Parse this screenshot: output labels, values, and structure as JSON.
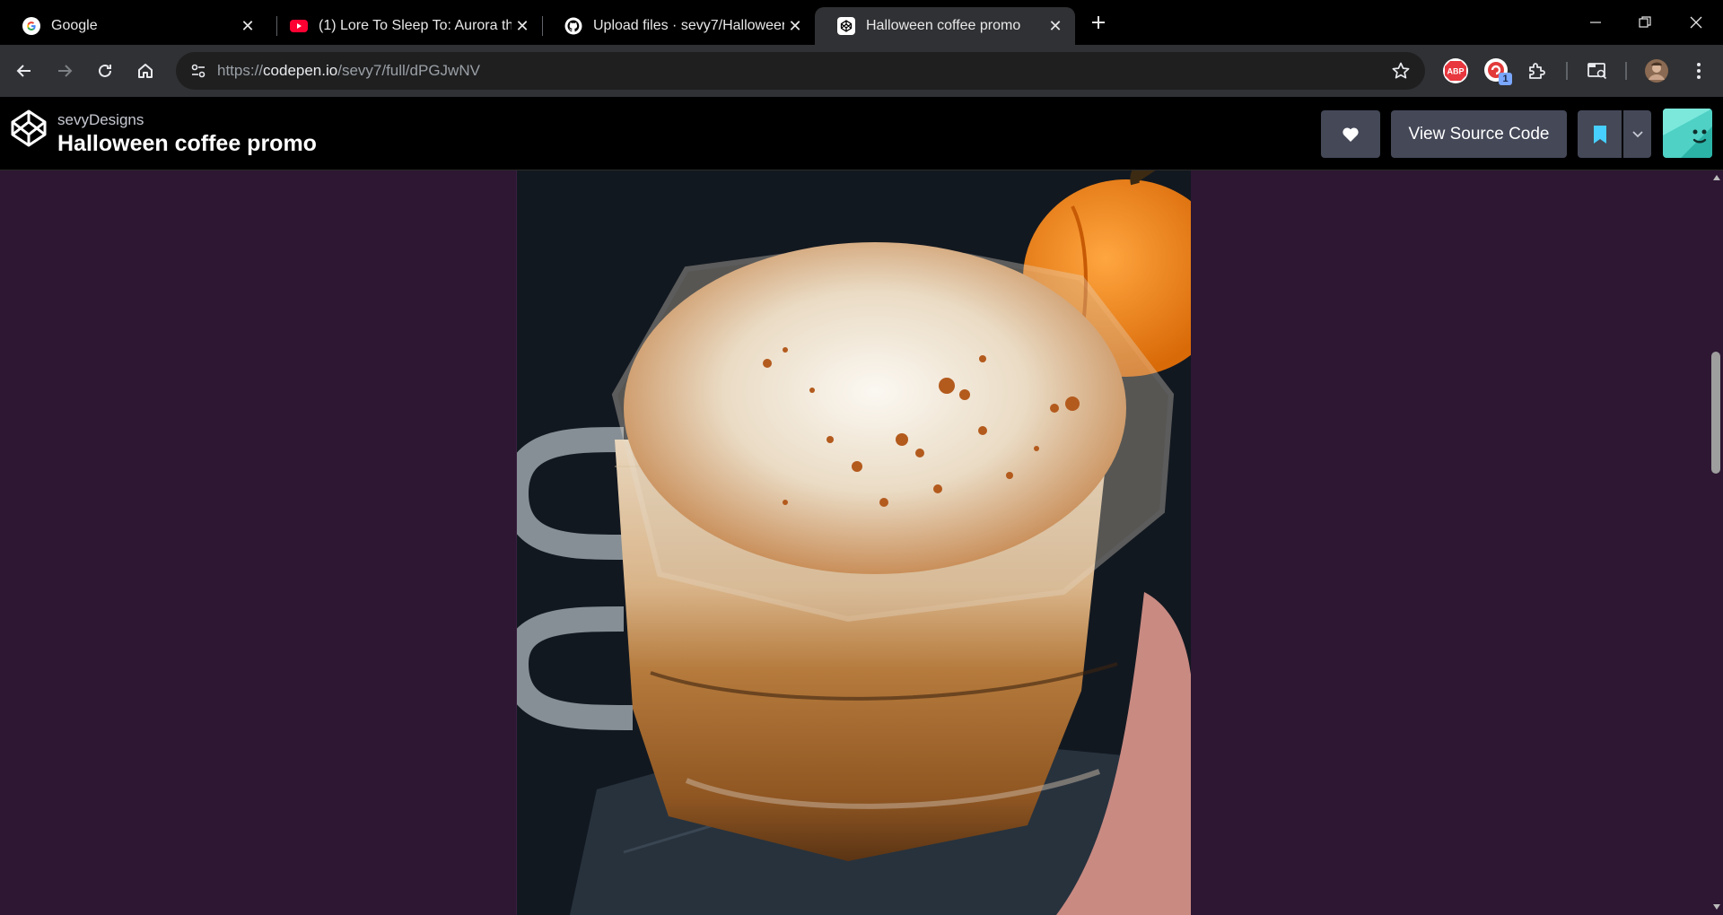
{
  "tabs": [
    {
      "title": "Google",
      "icon": "google-icon",
      "active": false
    },
    {
      "title": "(1) Lore To Sleep To: Aurora the",
      "icon": "youtube-icon",
      "active": false
    },
    {
      "title": "Upload files · sevy7/Halloween-",
      "icon": "github-icon",
      "active": false
    },
    {
      "title": "Halloween coffee promo",
      "icon": "codepen-icon",
      "active": true
    }
  ],
  "url": {
    "scheme": "https://",
    "host": "codepen.io",
    "path": "/sevy7/full/dPGJwNV"
  },
  "extensions": {
    "notification_badge": "1"
  },
  "codepen": {
    "author": "sevyDesigns",
    "title": "Halloween coffee promo",
    "view_source_label": "View Source Code"
  },
  "image": {
    "description_icon": "pumpkin-spice-latte-photo"
  },
  "colors": {
    "page_background": "#2d1733",
    "header_background": "#000000",
    "button_background": "#444857",
    "bookmark_accent": "#47cfff"
  }
}
